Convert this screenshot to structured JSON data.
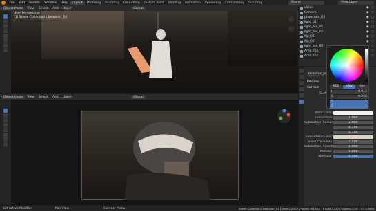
{
  "topbar": {
    "menus": [
      "File",
      "Edit",
      "Render",
      "Window",
      "Help"
    ],
    "workspaces": [
      "Layout",
      "Modeling",
      "Sculpting",
      "UV Editing",
      "Texture Paint",
      "Shading",
      "Animation",
      "Rendering",
      "Compositing",
      "Scripting"
    ],
    "active_workspace": "Layout",
    "scene_label": "Scene",
    "view_layer_label": "View Layer"
  },
  "viewport_top": {
    "mode": "Object Mode",
    "menus": [
      "View",
      "Select",
      "Add",
      "Object"
    ],
    "transform": "Global",
    "title": "User Perspective",
    "collection": "(1) Scene Collection | beauvoir_01"
  },
  "viewport_bottom": {
    "mode": "Object Mode",
    "menus": [
      "View",
      "Select",
      "Add",
      "Object"
    ],
    "transform": "Global",
    "options": "Options"
  },
  "outliner": {
    "rows": [
      "vision",
      "Camera",
      "plane.tool_01",
      "light_01",
      "light_tex_01",
      "light_tex_02",
      "Mp_01",
      "Mp_02",
      "light_tex_03",
      "Area.001",
      "Area.002"
    ]
  },
  "color_picker": {
    "tabs": [
      "RGB",
      "HSV",
      "Hex"
    ],
    "active_tab": "HSV",
    "fields": [
      {
        "label": "H",
        "value": "0.017"
      },
      {
        "label": "S",
        "value": "0.228"
      },
      {
        "label": "V",
        "value": "1"
      },
      {
        "label": "A",
        "value": "1"
      }
    ]
  },
  "properties": {
    "object_name": "beauvoir_01",
    "sections": [
      "Preview",
      "Surface"
    ],
    "surface_label": "Surf",
    "rows": [
      {
        "label": "Base Color",
        "value": "",
        "style": "white"
      },
      {
        "label": "Subsurface",
        "value": "0.000",
        "style": "grey"
      },
      {
        "label": "Subsurface Radius",
        "value": "1.000",
        "style": "grey"
      },
      {
        "label": "",
        "value": "0.200",
        "style": "grey"
      },
      {
        "label": "",
        "value": "0.100",
        "style": "grey"
      },
      {
        "label": "Subsurface Color",
        "value": "",
        "style": "beige"
      },
      {
        "label": "Subsurface IOR",
        "value": "1.400",
        "style": "grey"
      },
      {
        "label": "Subsurface Anisotr.",
        "value": "0.000",
        "style": "grey"
      },
      {
        "label": "Metallic",
        "value": "0.000",
        "style": "grey"
      },
      {
        "label": "Specular",
        "value": "0.500",
        "style": "blue"
      }
    ]
  },
  "statusbar": {
    "left": "Set Active Modifier",
    "mid1": "Pan View",
    "mid2": "Context Menu",
    "right": "Scene Collection | beauvoir_01 | Verts:22,613 | Faces:194,504 | Tris:881,220 | Objects:1/19 | 3.0.0 Beta"
  },
  "colors": {
    "accent": "#4772b3",
    "brand": "#e87d0d"
  }
}
